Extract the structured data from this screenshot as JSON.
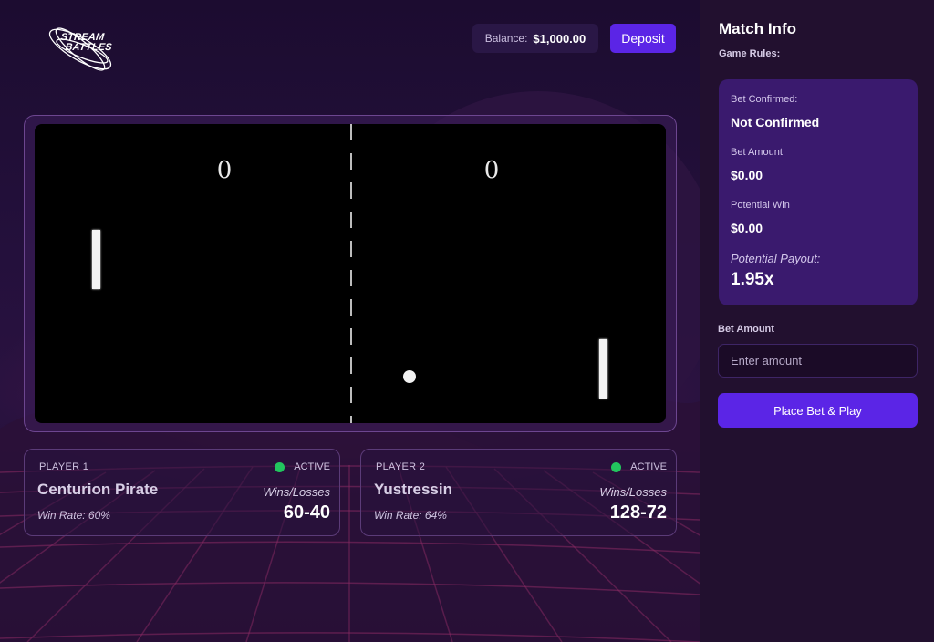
{
  "header": {
    "logo_line1": "STREAM",
    "logo_line2": "BATTLES",
    "balance_label": "Balance:",
    "balance_value": "$1,000.00",
    "deposit_label": "Deposit"
  },
  "game": {
    "score_left": "0",
    "score_right": "0"
  },
  "players": [
    {
      "label": "PLAYER 1",
      "status": "ACTIVE",
      "name": "Centurion Pirate",
      "win_rate": "Win Rate: 60%",
      "wl_label": "Wins/Losses",
      "wl_value": "60-40"
    },
    {
      "label": "PLAYER 2",
      "status": "ACTIVE",
      "name": "Yustressin",
      "win_rate": "Win Rate: 64%",
      "wl_label": "Wins/Losses",
      "wl_value": "128-72"
    }
  ],
  "sidebar": {
    "title": "Match Info",
    "rules_label": "Game Rules:",
    "bet_confirmed_label": "Bet Confirmed:",
    "bet_confirmed_value": "Not Confirmed",
    "bet_amount_label": "Bet Amount",
    "bet_amount_value": "$0.00",
    "potential_win_label": "Potential Win",
    "potential_win_value": "$0.00",
    "potential_payout_label": "Potential Payout:",
    "potential_payout_value": "1.95x",
    "bet_input_label": "Bet Amount",
    "bet_input_placeholder": "Enter amount",
    "play_button_label": "Place Bet & Play"
  },
  "colors": {
    "accent": "#5b25e6",
    "active_status": "#22c55e",
    "card_bg": "#3a1a6e"
  }
}
